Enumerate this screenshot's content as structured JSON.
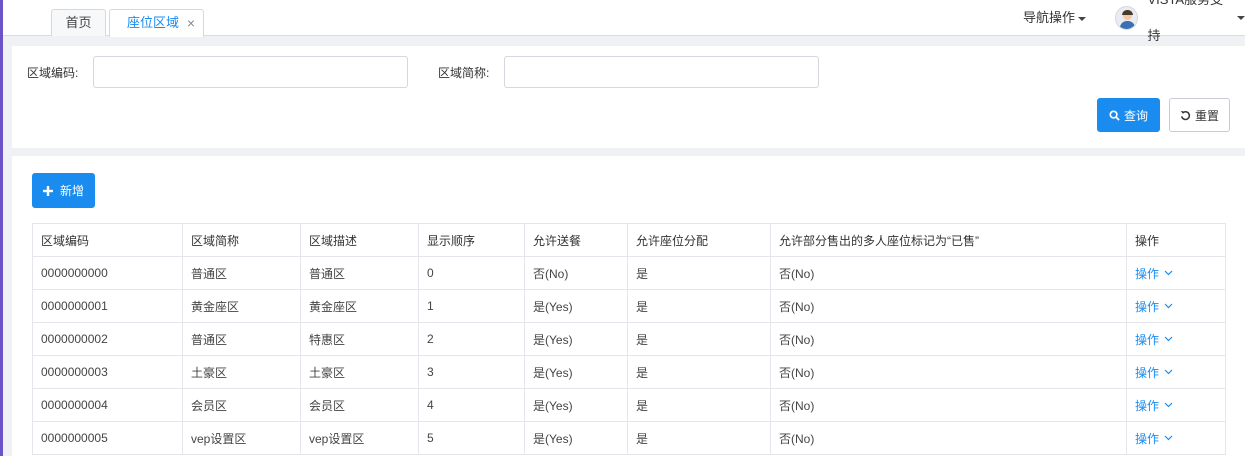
{
  "tabs": [
    {
      "label": "首页"
    },
    {
      "label": "座位区域",
      "close": "×"
    }
  ],
  "header": {
    "nav_op": "导航操作",
    "user_name": "VISTA服务支持"
  },
  "search": {
    "code_label": "区域编码:",
    "code_value": "",
    "name_label": "区域简称:",
    "name_value": "",
    "query_label": "查询",
    "reset_label": "重置"
  },
  "toolbar": {
    "add_label": "新增"
  },
  "table": {
    "columns": [
      "区域编码",
      "区域简称",
      "区域描述",
      "显示顺序",
      "允许送餐",
      "允许座位分配",
      "允许部分售出的多人座位标记为“已售”",
      "操作"
    ],
    "rows": [
      {
        "code": "0000000000",
        "short": "普通区",
        "desc": "普通区",
        "order": "0",
        "meal": "否(No)",
        "assign": "是",
        "sold": "否(No)",
        "op": "操作"
      },
      {
        "code": "0000000001",
        "short": "黄金座区",
        "desc": "黄金座区",
        "order": "1",
        "meal": "是(Yes)",
        "assign": "是",
        "sold": "否(No)",
        "op": "操作"
      },
      {
        "code": "0000000002",
        "short": "普通区",
        "desc": "特惠区",
        "order": "2",
        "meal": "是(Yes)",
        "assign": "是",
        "sold": "否(No)",
        "op": "操作"
      },
      {
        "code": "0000000003",
        "short": "土豪区",
        "desc": "土豪区",
        "order": "3",
        "meal": "是(Yes)",
        "assign": "是",
        "sold": "否(No)",
        "op": "操作"
      },
      {
        "code": "0000000004",
        "short": "会员区",
        "desc": "会员区",
        "order": "4",
        "meal": "是(Yes)",
        "assign": "是",
        "sold": "否(No)",
        "op": "操作"
      },
      {
        "code": "0000000005",
        "short": "vep设置区",
        "desc": "vep设置区",
        "order": "5",
        "meal": "是(Yes)",
        "assign": "是",
        "sold": "否(No)",
        "op": "操作"
      }
    ]
  },
  "colors": {
    "primary": "#1a8cf0",
    "accent_edge": "#6a54c8"
  }
}
